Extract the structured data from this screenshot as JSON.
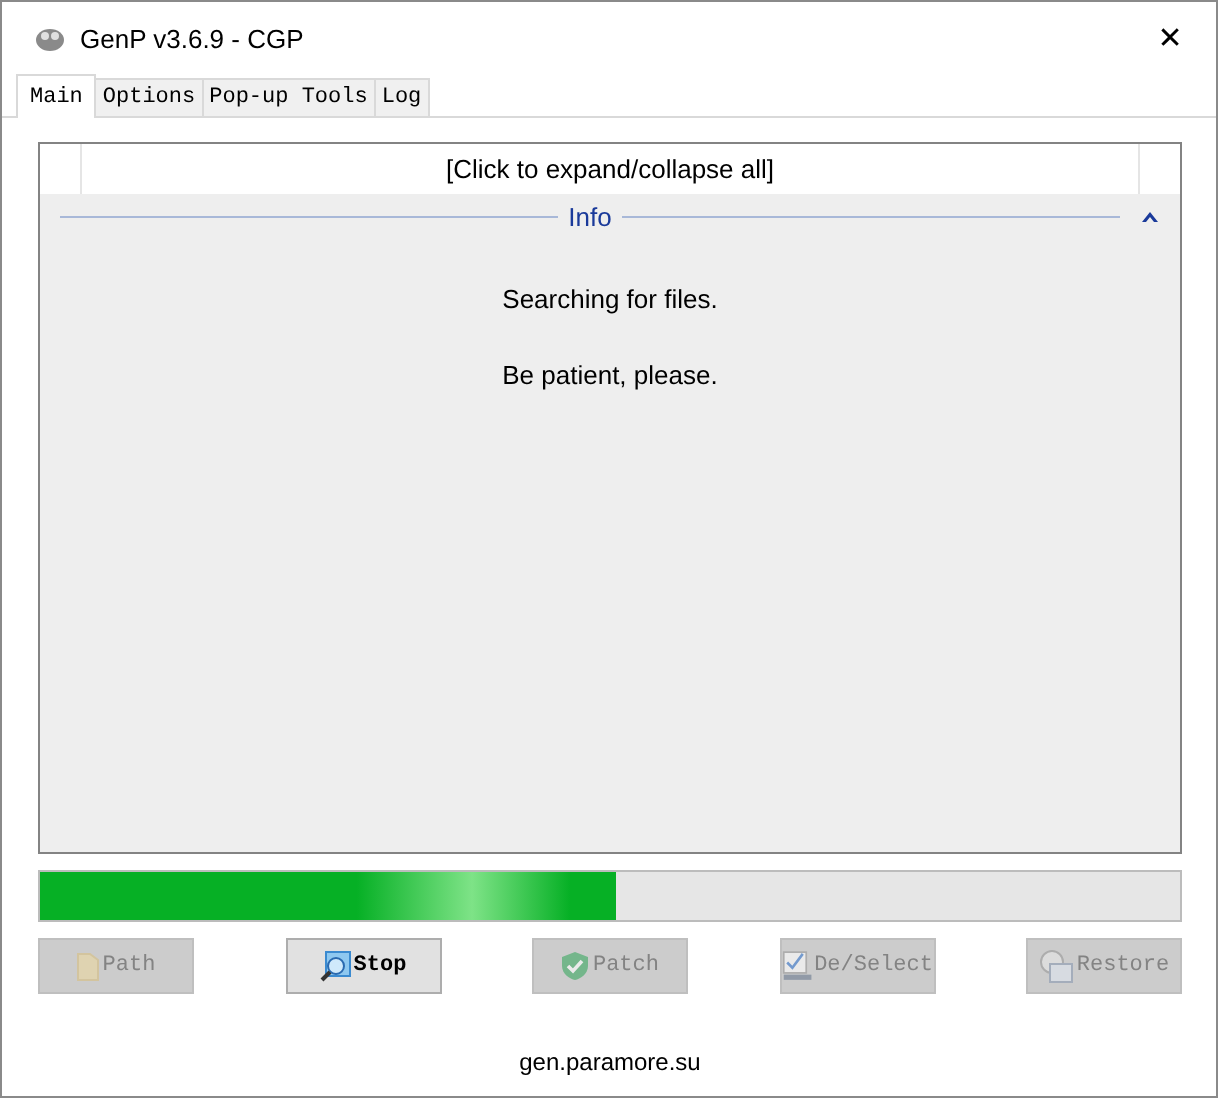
{
  "window": {
    "title": "GenP v3.6.9 - CGP",
    "close_glyph": "✕"
  },
  "tabs": [
    {
      "label": "Main",
      "selected": true
    },
    {
      "label": "Options",
      "selected": false
    },
    {
      "label": "Pop-up Tools",
      "selected": false
    },
    {
      "label": "Log",
      "selected": false
    }
  ],
  "tree": {
    "header": "[Click to expand/collapse all]",
    "group": {
      "title": "Info",
      "expanded": true,
      "lines": [
        "Searching for files.",
        "Be patient, please."
      ]
    }
  },
  "progress": {
    "level": 0.506
  },
  "buttons": [
    {
      "label": "Path",
      "kind": "folder",
      "disabled": true
    },
    {
      "label": "Stop",
      "kind": "search",
      "disabled": false
    },
    {
      "label": "Patch",
      "kind": "shield",
      "disabled": true
    },
    {
      "label": "De/Select",
      "kind": "checklist",
      "disabled": true
    },
    {
      "label": "Restore",
      "kind": "restore",
      "disabled": true
    }
  ],
  "footer": "gen.paramore.su"
}
